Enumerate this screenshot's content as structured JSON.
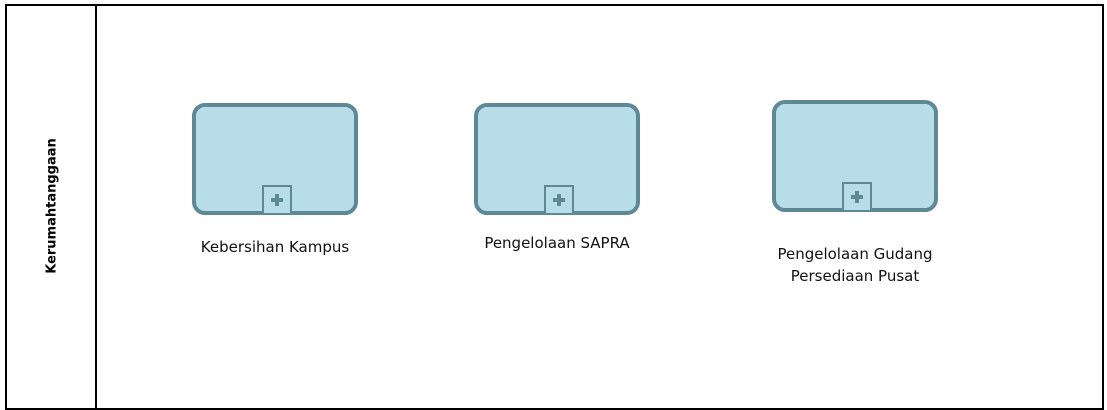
{
  "lane": {
    "title": "Kerumahtanggaan"
  },
  "subprocesses": [
    {
      "label": "Kebersihan Kampus",
      "marker_icon": "plus-icon"
    },
    {
      "label": "Pengelolaan SAPRA",
      "marker_icon": "plus-icon"
    },
    {
      "label_lines": [
        "Pengelolaan Gudang",
        "Persediaan Pusat"
      ],
      "marker_icon": "plus-icon"
    }
  ],
  "colors": {
    "task_fill": "#b7dde9",
    "task_border": "#5f8896",
    "lane_border": "#000000"
  }
}
